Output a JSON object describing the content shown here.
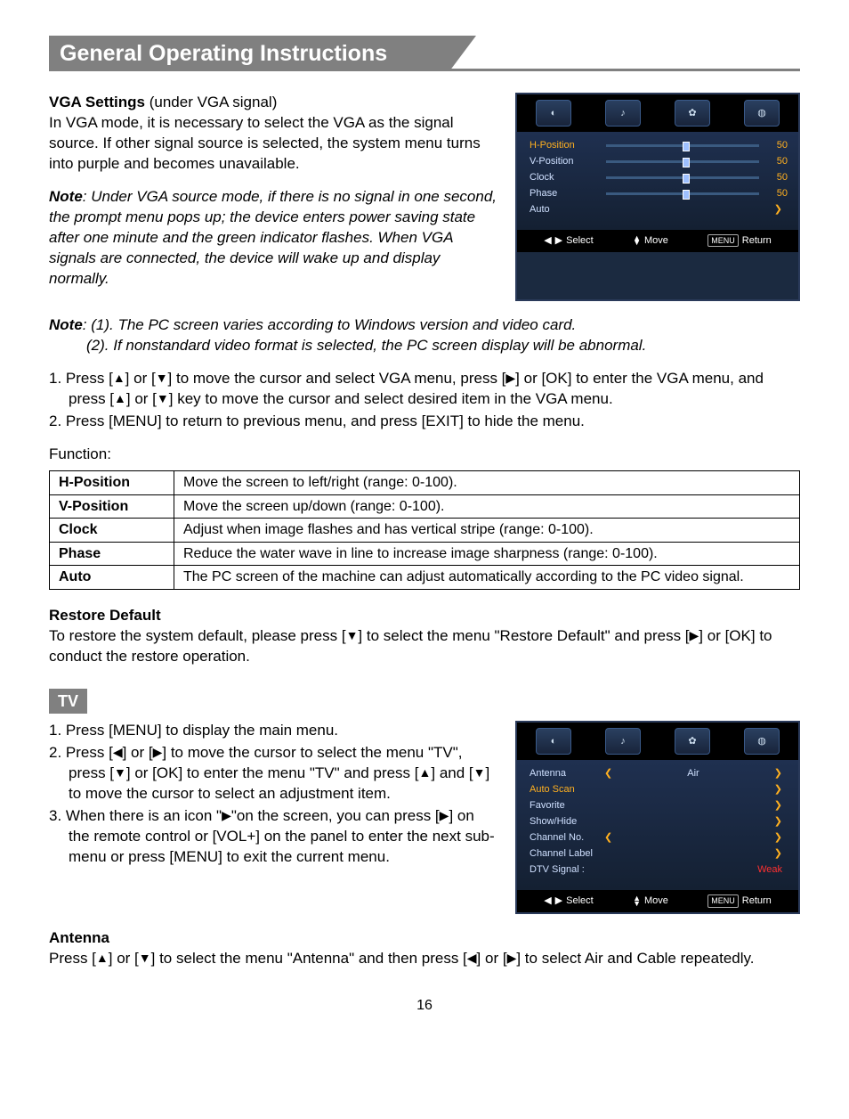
{
  "header": "General Operating Instructions",
  "vga": {
    "title": "VGA Settings",
    "title_suffix": " (under VGA signal)",
    "intro": "In VGA mode, it is necessary to select the VGA as the signal source. If other signal source is selected, the system menu turns into purple and becomes unavailable.",
    "note_label": "Note",
    "note_body": ": Under VGA source mode, if there is no signal in one second, the prompt menu pops up; the device enters power saving state after one minute and the green indicator flashes. When VGA signals are connected, the device will wake up and display normally.",
    "osd": {
      "rows": [
        {
          "label": "H-Position",
          "value": "50",
          "selected": true,
          "type": "slider"
        },
        {
          "label": "V-Position",
          "value": "50",
          "type": "slider"
        },
        {
          "label": "Clock",
          "value": "50",
          "type": "slider"
        },
        {
          "label": "Phase",
          "value": "50",
          "type": "slider"
        },
        {
          "label": "Auto",
          "type": "enter"
        }
      ],
      "foot": {
        "select": "Select",
        "move": "Move",
        "menu": "MENU",
        "ret": "Return"
      }
    }
  },
  "notes2": {
    "label": "Note",
    "l1": ": (1). The PC screen varies according to Windows version and video card.",
    "l2": "(2). If nonstandard video format is selected, the PC screen display will be abnormal."
  },
  "steps1": {
    "s1a": "1. Press [",
    "s1b": "] or [",
    "s1c": "] to move the cursor and select VGA menu, press [",
    "s1d": "] or [OK] to enter the VGA menu, and press [",
    "s1e": "] or [",
    "s1f": "] key to move the cursor and select desired item in the VGA menu.",
    "s2": "2. Press [MENU] to return to previous menu, and press [EXIT] to hide the menu."
  },
  "func": {
    "title": "Function:",
    "rows": [
      {
        "h": "H-Position",
        "d": "Move the screen to left/right (range: 0-100)."
      },
      {
        "h": "V-Position",
        "d": "Move the screen up/down (range: 0-100)."
      },
      {
        "h": "Clock",
        "d": "Adjust when image flashes and has vertical stripe (range: 0-100)."
      },
      {
        "h": "Phase",
        "d": "Reduce the water wave in line to increase image sharpness (range: 0-100)."
      },
      {
        "h": "Auto",
        "d": "The PC screen of the machine can adjust automatically according to the PC video signal."
      }
    ]
  },
  "restore": {
    "title": "Restore Default",
    "a": "To restore the system default, please press [",
    "b": "] to select the menu \"Restore Default\" and press [",
    "c": "] or [OK] to conduct the restore operation."
  },
  "tv": {
    "chip": "TV",
    "s1": "1. Press [MENU] to display the main menu.",
    "s2a": "2. Press [",
    "s2b": "] or [",
    "s2c": "] to move the cursor to select the menu \"TV\", press [",
    "s2d": "] or [OK] to enter the menu \"TV\" and press [",
    "s2e": "] and [",
    "s2f": "] to move the cursor to select an adjustment item.",
    "s3a": "3. When there is an icon \"",
    "s3b": "\"on the screen, you can press [",
    "s3c": "] on the remote control or [VOL+] on the panel to enter the next sub-menu or press [MENU] to exit the current menu.",
    "osd": {
      "rows": [
        {
          "label": "Antenna",
          "type": "spin",
          "value": "Air"
        },
        {
          "label": "Auto Scan",
          "type": "enter",
          "selected": true
        },
        {
          "label": "Favorite",
          "type": "enter"
        },
        {
          "label": "Show/Hide",
          "type": "enter"
        },
        {
          "label": "Channel No.",
          "type": "spin",
          "value": ""
        },
        {
          "label": "Channel Label",
          "type": "enter"
        },
        {
          "label": "DTV Signal :",
          "type": "text",
          "value": "Weak",
          "weak": true
        }
      ],
      "foot": {
        "select": "Select",
        "move": "Move",
        "menu": "MENU",
        "ret": "Return"
      }
    }
  },
  "antenna": {
    "title": "Antenna",
    "a": "Press [",
    "b": "] or [",
    "c": "] to select the menu \"Antenna\" and then press [",
    "d": "] or [",
    "e": "] to select Air and Cable repeatedly."
  },
  "page": "16",
  "glyphs": {
    "up": "▲",
    "down": "▼",
    "left": "◀",
    "right": "▶",
    "renter": "❯",
    "lenter": "❮",
    "updn": "▲\n▼"
  }
}
